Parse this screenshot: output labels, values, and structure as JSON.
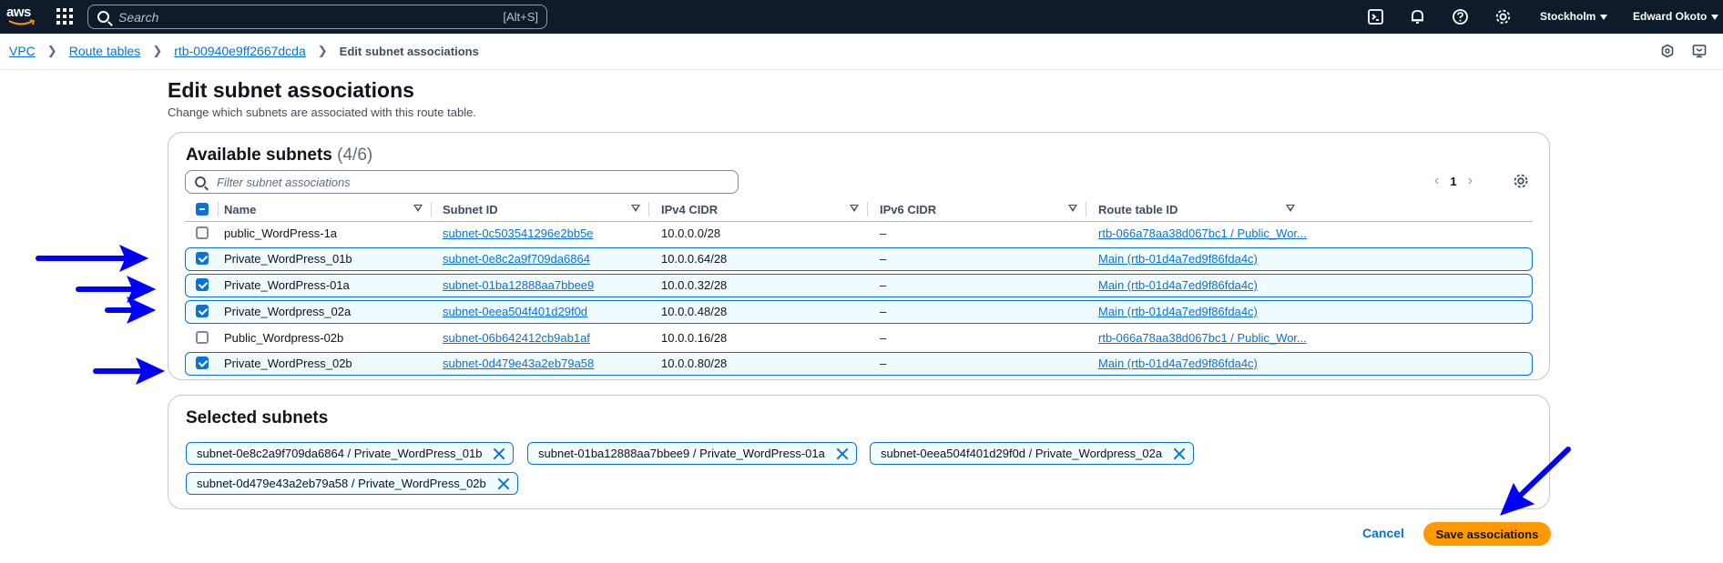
{
  "topnav": {
    "logo_text": "aws",
    "search_placeholder": "Search",
    "search_shortcut": "[Alt+S]",
    "region": "Stockholm",
    "user": "Edward Okoto"
  },
  "breadcrumb": {
    "items": [
      "VPC",
      "Route tables",
      "rtb-00940e9ff2667dcda"
    ],
    "current": "Edit subnet associations"
  },
  "page": {
    "title": "Edit subnet associations",
    "description": "Change which subnets are associated with this route table."
  },
  "available": {
    "title": "Available subnets",
    "count": "(4/6)",
    "filter_placeholder": "Filter subnet associations",
    "page_number": "1",
    "columns": [
      "Name",
      "Subnet ID",
      "IPv4 CIDR",
      "IPv6 CIDR",
      "Route table ID"
    ],
    "rows": [
      {
        "name": "public_WordPress-1a",
        "subnet_id": "subnet-0c503541296e2bb5e",
        "ipv4": "10.0.0.0/28",
        "ipv6": "–",
        "route_table": "rtb-066a78aa38d067bc1 / Public_Wor...",
        "checked": false
      },
      {
        "name": "Private_WordPress_01b",
        "subnet_id": "subnet-0e8c2a9f709da6864",
        "ipv4": "10.0.0.64/28",
        "ipv6": "–",
        "route_table": "Main (rtb-01d4a7ed9f86fda4c)",
        "checked": true
      },
      {
        "name": "Private_WordPress-01a",
        "subnet_id": "subnet-01ba12888aa7bbee9",
        "ipv4": "10.0.0.32/28",
        "ipv6": "–",
        "route_table": "Main (rtb-01d4a7ed9f86fda4c)",
        "checked": true
      },
      {
        "name": "Private_Wordpress_02a",
        "subnet_id": "subnet-0eea504f401d29f0d",
        "ipv4": "10.0.0.48/28",
        "ipv6": "–",
        "route_table": "Main (rtb-01d4a7ed9f86fda4c)",
        "checked": true
      },
      {
        "name": "Public_Wordpress-02b",
        "subnet_id": "subnet-06b642412cb9ab1af",
        "ipv4": "10.0.0.16/28",
        "ipv6": "–",
        "route_table": "rtb-066a78aa38d067bc1 / Public_Wor...",
        "checked": false
      },
      {
        "name": "Private_WordPress_02b",
        "subnet_id": "subnet-0d479e43a2eb79a58",
        "ipv4": "10.0.0.80/28",
        "ipv6": "–",
        "route_table": "Main (rtb-01d4a7ed9f86fda4c)",
        "checked": true
      }
    ]
  },
  "selected": {
    "title": "Selected subnets",
    "tokens": [
      "subnet-0e8c2a9f709da6864 / Private_WordPress_01b",
      "subnet-01ba12888aa7bbee9 / Private_WordPress-01a",
      "subnet-0eea504f401d29f0d / Private_Wordpress_02a",
      "subnet-0d479e43a2eb79a58 / Private_WordPress_02b"
    ]
  },
  "footer": {
    "cancel_label": "Cancel",
    "save_label": "Save associations"
  },
  "colors": {
    "nav_bg": "#0f1b2a",
    "link": "#0972d3",
    "primary_button": "#ff9900",
    "annotation_arrow": "#0000ff"
  }
}
